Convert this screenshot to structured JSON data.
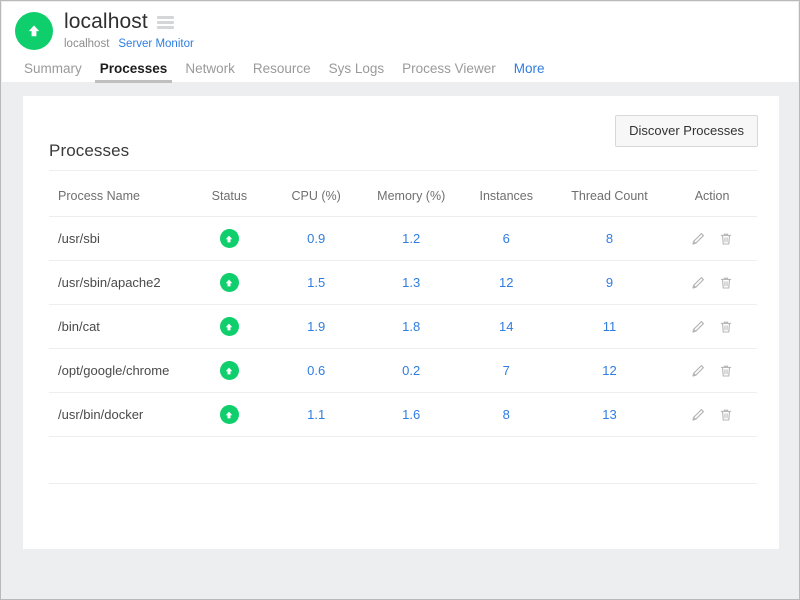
{
  "header": {
    "logo_icon": "green-circle-up-arrow-icon",
    "host_title": "localhost",
    "menu_icon": "hamburger-menu-icon",
    "breadcrumb": {
      "host": "localhost",
      "app": "Server Monitor"
    }
  },
  "tabs": [
    {
      "label": "Summary",
      "active": false
    },
    {
      "label": "Processes",
      "active": true
    },
    {
      "label": "Network",
      "active": false
    },
    {
      "label": "Resource",
      "active": false
    },
    {
      "label": "Sys Logs",
      "active": false
    },
    {
      "label": "Process Viewer",
      "active": false
    },
    {
      "label": "More",
      "active": false,
      "link": true
    }
  ],
  "toolbar": {
    "discover_label": "Discover Processes"
  },
  "section": {
    "title": "Processes"
  },
  "table": {
    "columns": [
      "Process Name",
      "Status",
      "CPU (%)",
      "Memory (%)",
      "Instances",
      "Thread Count",
      "Action"
    ],
    "rows": [
      {
        "name": "/usr/sbi",
        "status": "up",
        "cpu": "0.9",
        "memory": "1.2",
        "instances": "6",
        "threads": "8",
        "actions": [
          "edit-icon",
          "delete-icon"
        ]
      },
      {
        "name": "/usr/sbin/apache2",
        "status": "up",
        "cpu": "1.5",
        "memory": "1.3",
        "instances": "12",
        "threads": "9",
        "actions": [
          "edit-icon",
          "delete-icon"
        ]
      },
      {
        "name": "/bin/cat",
        "status": "up",
        "cpu": "1.9",
        "memory": "1.8",
        "instances": "14",
        "threads": "11",
        "actions": [
          "edit-icon",
          "delete-icon"
        ]
      },
      {
        "name": "/opt/google/chrome",
        "status": "up",
        "cpu": "0.6",
        "memory": "0.2",
        "instances": "7",
        "threads": "12",
        "actions": [
          "edit-icon",
          "delete-icon"
        ]
      },
      {
        "name": "/usr/bin/docker",
        "status": "up",
        "cpu": "1.1",
        "memory": "1.6",
        "instances": "8",
        "threads": "13",
        "actions": [
          "edit-icon",
          "delete-icon"
        ]
      }
    ]
  },
  "colors": {
    "brand_green": "#0fce6c",
    "link_blue": "#2f7de1",
    "value_blue": "#2f7de1",
    "page_bg": "#edeef0",
    "card_bg": "#ffffff"
  }
}
